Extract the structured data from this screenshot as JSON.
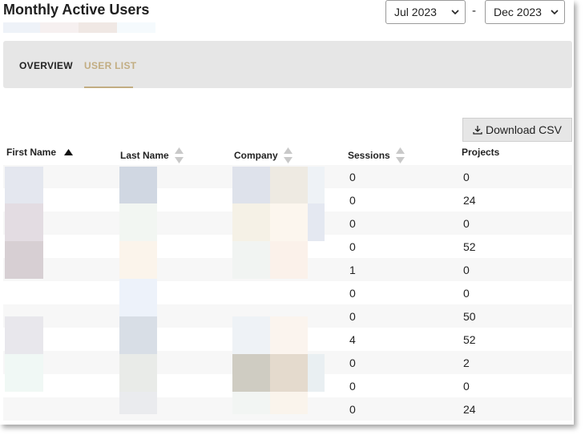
{
  "header": {
    "title": "Monthly Active Users",
    "date_from": "Jul 2023",
    "date_to": "Dec 2023",
    "range_separator": "-"
  },
  "tabs": [
    {
      "label": "OVERVIEW",
      "active": false
    },
    {
      "label": "USER LIST",
      "active": true
    }
  ],
  "colors": {
    "accent": "#c2ad82",
    "tab_bar": "#e6e6e6"
  },
  "toolbar": {
    "download_label": "Download CSV",
    "download_icon": "download-icon"
  },
  "table": {
    "columns": [
      {
        "label": "First Name",
        "sort": "ascending"
      },
      {
        "label": "Last Name",
        "sort": "sortable"
      },
      {
        "label": "Company",
        "sort": "sortable"
      },
      {
        "label": "Sessions",
        "sort": "sortable"
      },
      {
        "label": "Projects",
        "sort": "none"
      }
    ],
    "rows": [
      {
        "sessions": "0",
        "projects": "0"
      },
      {
        "sessions": "0",
        "projects": "24"
      },
      {
        "sessions": "0",
        "projects": "0"
      },
      {
        "sessions": "0",
        "projects": "52"
      },
      {
        "sessions": "1",
        "projects": "0"
      },
      {
        "sessions": "0",
        "projects": "0"
      },
      {
        "sessions": "0",
        "projects": "50"
      },
      {
        "sessions": "4",
        "projects": "52"
      },
      {
        "sessions": "0",
        "projects": "2"
      },
      {
        "sessions": "0",
        "projects": "0"
      },
      {
        "sessions": "0",
        "projects": "24"
      }
    ]
  }
}
